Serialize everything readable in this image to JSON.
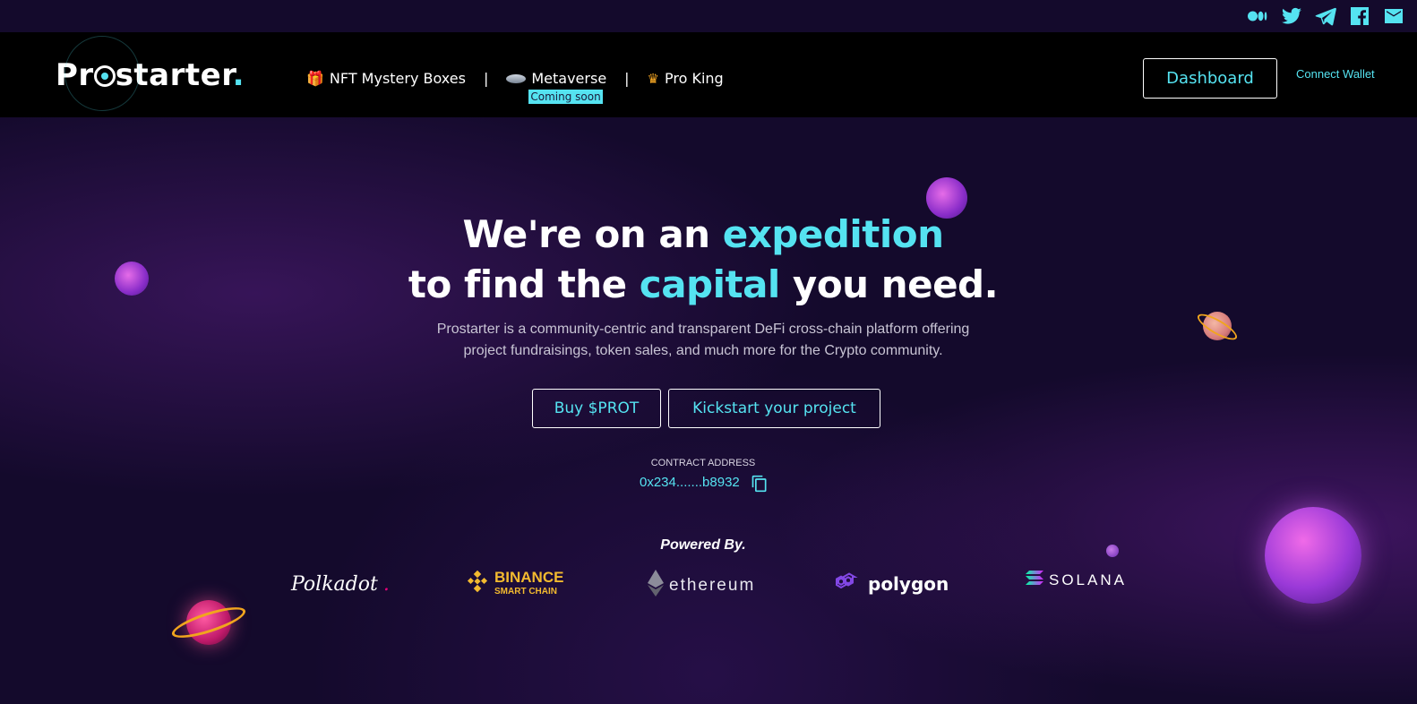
{
  "social": {
    "icons": [
      "medium-icon",
      "twitter-icon",
      "telegram-icon",
      "facebook-icon",
      "mail-icon"
    ]
  },
  "nav": {
    "logo_text": "Pr",
    "logo_text2": "starter",
    "logo_dot": ".",
    "items": [
      {
        "label": "NFT Mystery Boxes",
        "icon": "gift-icon"
      },
      {
        "label": "Metaverse",
        "icon": "ufo-icon",
        "badge": "Coming soon"
      },
      {
        "label": "Pro King",
        "icon": "crown-icon"
      }
    ],
    "separator": "|",
    "dashboard": "Dashboard",
    "connect_wallet": "Connect Wallet"
  },
  "hero": {
    "line1_a": "We're on an ",
    "line1_hl": "expedition",
    "line2_a": "to find the ",
    "line2_hl": "capital",
    "line2_b": " you need.",
    "sub_line1": "Prostarter is a community-centric and transparent DeFi cross-chain platform offering",
    "sub_line2": "project fundraisings, token sales, and much more for the Crypto community.",
    "buy_btn": "Buy $PROT",
    "kick_btn": "Kickstart your project",
    "contract_label": "CONTRACT ADDRESS",
    "contract_address": "0x234.......b8932"
  },
  "powered": {
    "label": "Powered By.",
    "chains": {
      "polkadot": "Polkadot",
      "polkadot_dot": ".",
      "binance_1": "BINANCE",
      "binance_2": "SMART CHAIN",
      "ethereum": "ethereum",
      "polygon": "polygon",
      "solana": "SOLANA"
    }
  },
  "colors": {
    "accent": "#55e3f1",
    "background": "#140a2c",
    "navbar": "#000000"
  }
}
